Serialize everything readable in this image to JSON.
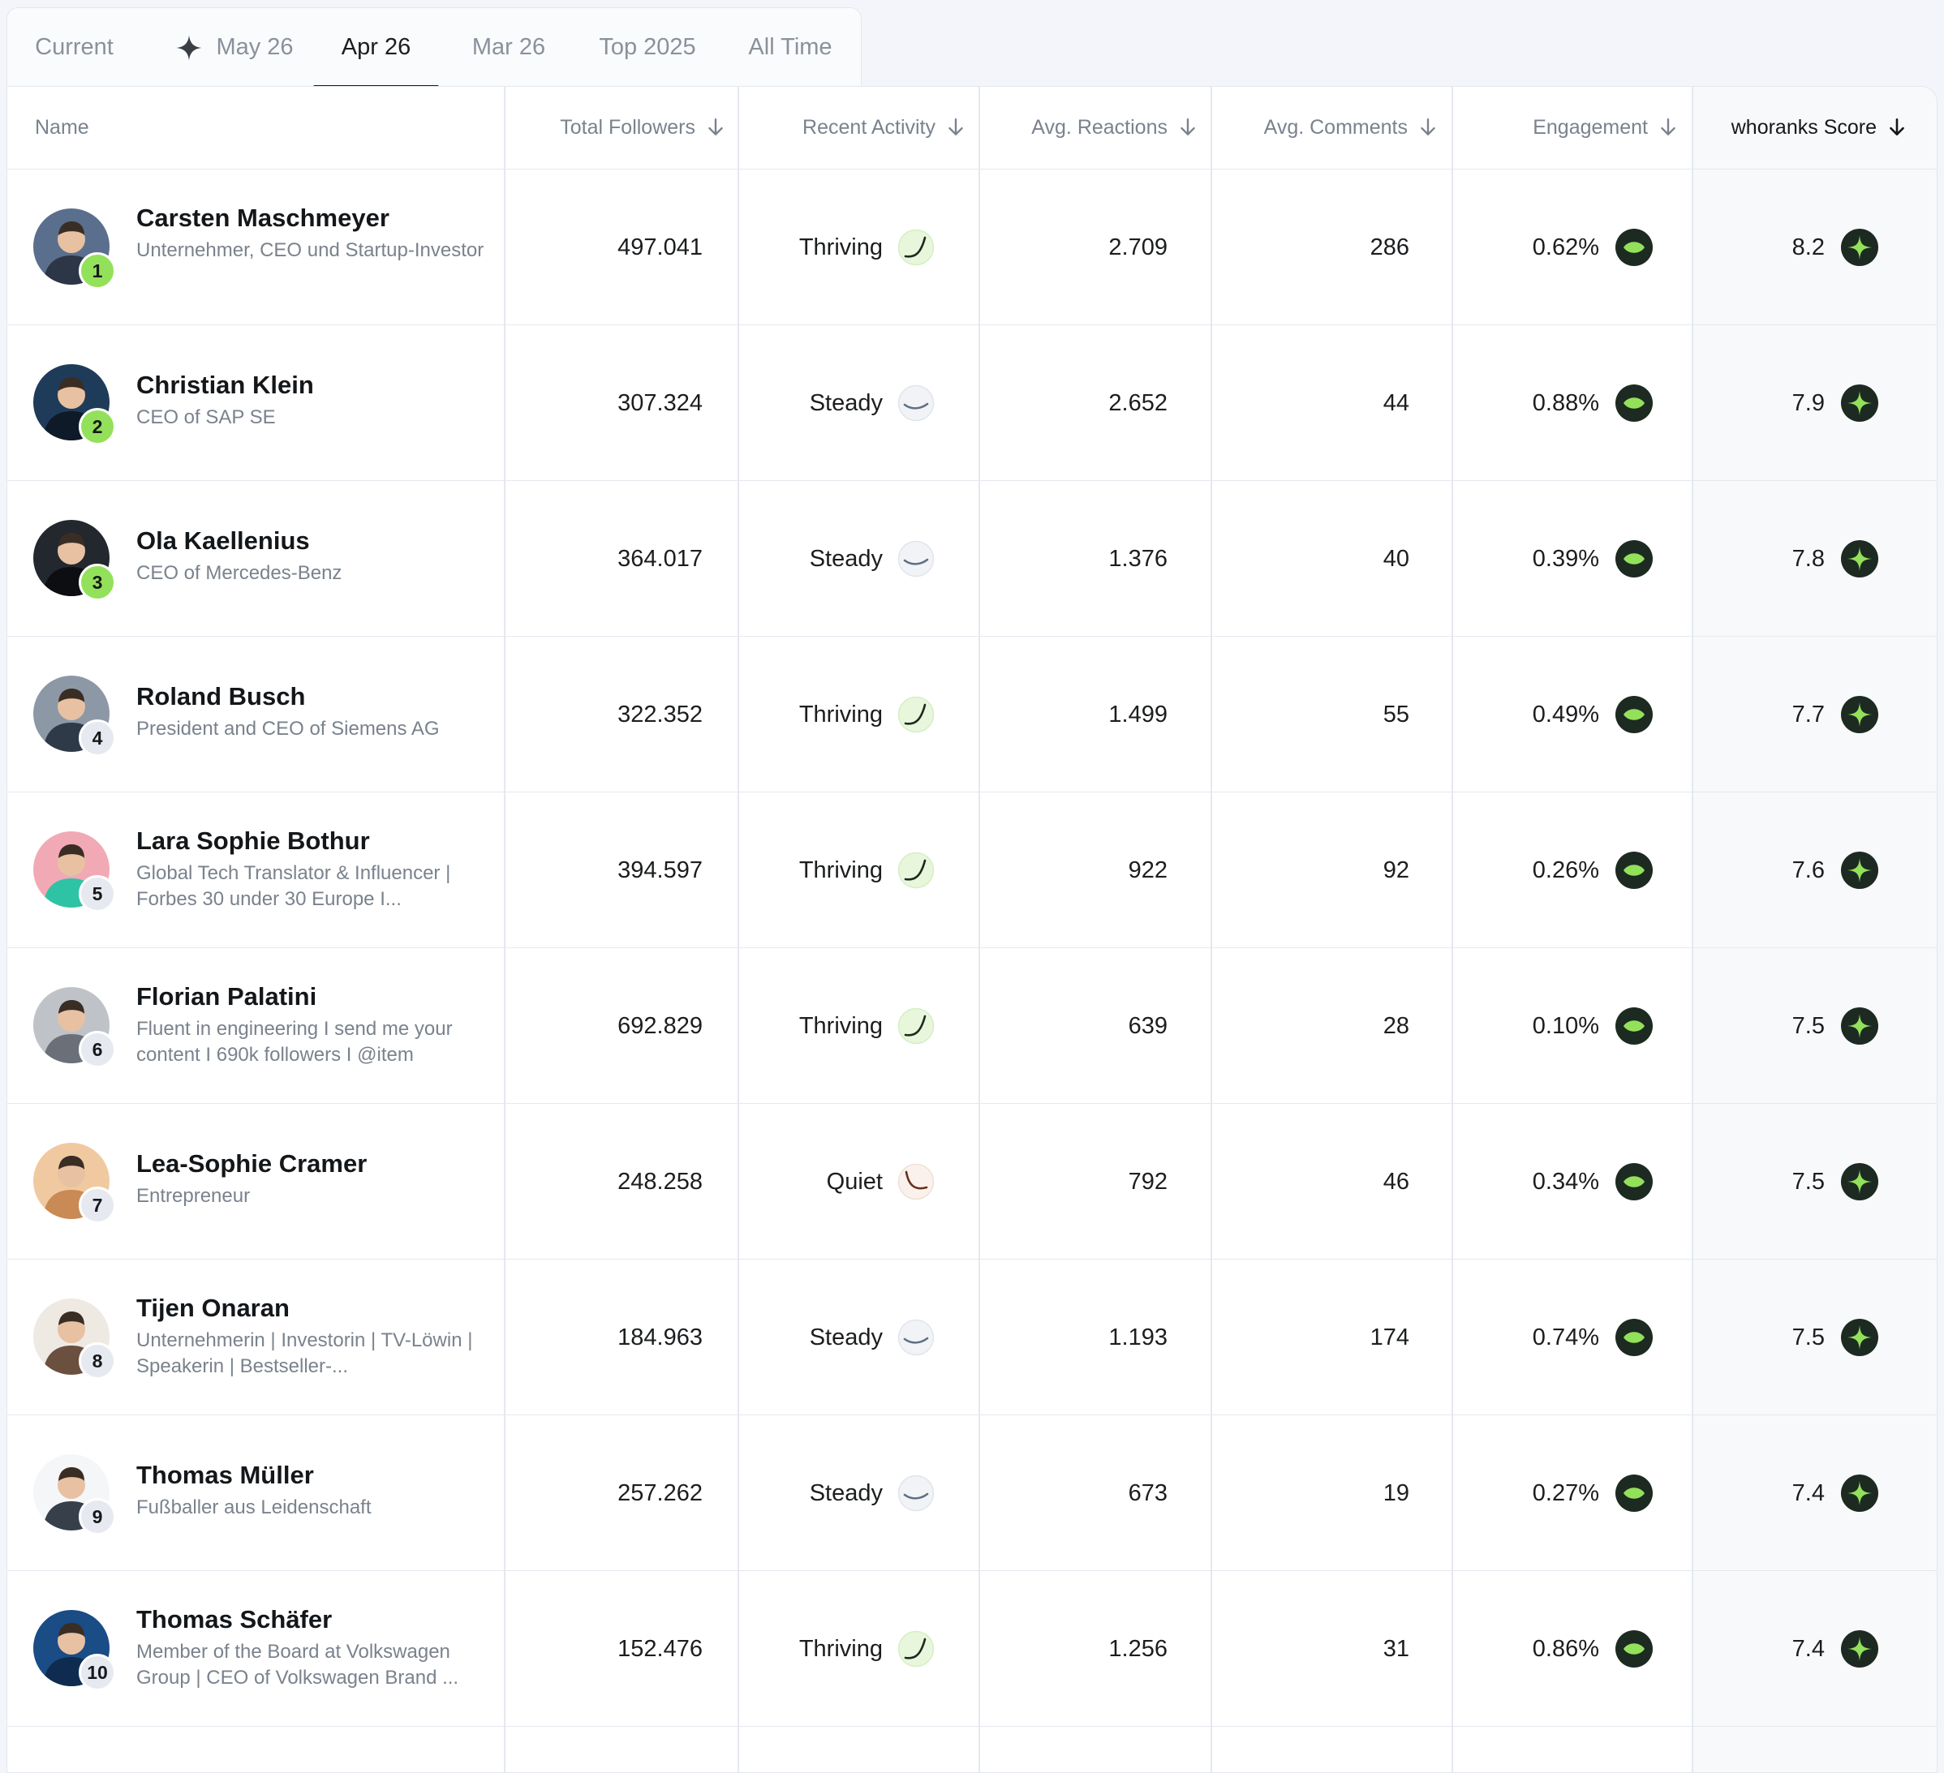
{
  "tabs": [
    {
      "label": "Current",
      "icon": null,
      "active": false
    },
    {
      "label": "May 26",
      "icon": "sparkle-icon",
      "active": false
    },
    {
      "label": "Apr 26",
      "icon": null,
      "active": true
    },
    {
      "label": "Mar 26",
      "icon": null,
      "active": false
    },
    {
      "label": "Top 2025",
      "icon": null,
      "active": false
    },
    {
      "label": "All Time",
      "icon": null,
      "active": false
    }
  ],
  "columns": {
    "name": "Name",
    "followers": "Total Followers",
    "activity": "Recent Activity",
    "reactions": "Avg. Reactions",
    "comments": "Avg. Comments",
    "engagement": "Engagement",
    "score": "whoranks Score"
  },
  "colors": {
    "accent_green": "#93e15a",
    "badge_dark": "#1d2a22",
    "text_muted": "#7a828d"
  },
  "rows": [
    {
      "rank": "1",
      "name": "Carsten Maschmeyer",
      "subtitle": "Unternehmer, CEO und Startup-Investor",
      "followers": "497.041",
      "activity": "Thriving",
      "reactions": "2.709",
      "comments": "286",
      "engagement": "0.62%",
      "score": "8.2"
    },
    {
      "rank": "2",
      "name": "Christian Klein",
      "subtitle": "CEO of SAP SE",
      "followers": "307.324",
      "activity": "Steady",
      "reactions": "2.652",
      "comments": "44",
      "engagement": "0.88%",
      "score": "7.9"
    },
    {
      "rank": "3",
      "name": "Ola Kaellenius",
      "subtitle": "CEO of Mercedes-Benz",
      "followers": "364.017",
      "activity": "Steady",
      "reactions": "1.376",
      "comments": "40",
      "engagement": "0.39%",
      "score": "7.8"
    },
    {
      "rank": "4",
      "name": "Roland Busch",
      "subtitle": "President and CEO of Siemens AG",
      "followers": "322.352",
      "activity": "Thriving",
      "reactions": "1.499",
      "comments": "55",
      "engagement": "0.49%",
      "score": "7.7"
    },
    {
      "rank": "5",
      "name": "Lara Sophie Bothur",
      "subtitle": "Global Tech Translator & Influencer | Forbes 30 under 30 Europe I...",
      "followers": "394.597",
      "activity": "Thriving",
      "reactions": "922",
      "comments": "92",
      "engagement": "0.26%",
      "score": "7.6"
    },
    {
      "rank": "6",
      "name": "Florian Palatini",
      "subtitle": "Fluent in engineering I send me your content I 690k followers I @item",
      "followers": "692.829",
      "activity": "Thriving",
      "reactions": "639",
      "comments": "28",
      "engagement": "0.10%",
      "score": "7.5"
    },
    {
      "rank": "7",
      "name": "Lea-Sophie Cramer",
      "subtitle": "Entrepreneur",
      "followers": "248.258",
      "activity": "Quiet",
      "reactions": "792",
      "comments": "46",
      "engagement": "0.34%",
      "score": "7.5"
    },
    {
      "rank": "8",
      "name": "Tijen Onaran",
      "subtitle": "Unternehmerin | Investorin | TV-Löwin | Speakerin | Bestseller-...",
      "followers": "184.963",
      "activity": "Steady",
      "reactions": "1.193",
      "comments": "174",
      "engagement": "0.74%",
      "score": "7.5"
    },
    {
      "rank": "9",
      "name": "Thomas Müller",
      "subtitle": "Fußballer aus Leidenschaft",
      "followers": "257.262",
      "activity": "Steady",
      "reactions": "673",
      "comments": "19",
      "engagement": "0.27%",
      "score": "7.4"
    },
    {
      "rank": "10",
      "name": "Thomas Schäfer",
      "subtitle": "Member of the Board at Volkswagen Group | CEO of Volkswagen Brand ...",
      "followers": "152.476",
      "activity": "Thriving",
      "reactions": "1.256",
      "comments": "31",
      "engagement": "0.86%",
      "score": "7.4"
    }
  ]
}
